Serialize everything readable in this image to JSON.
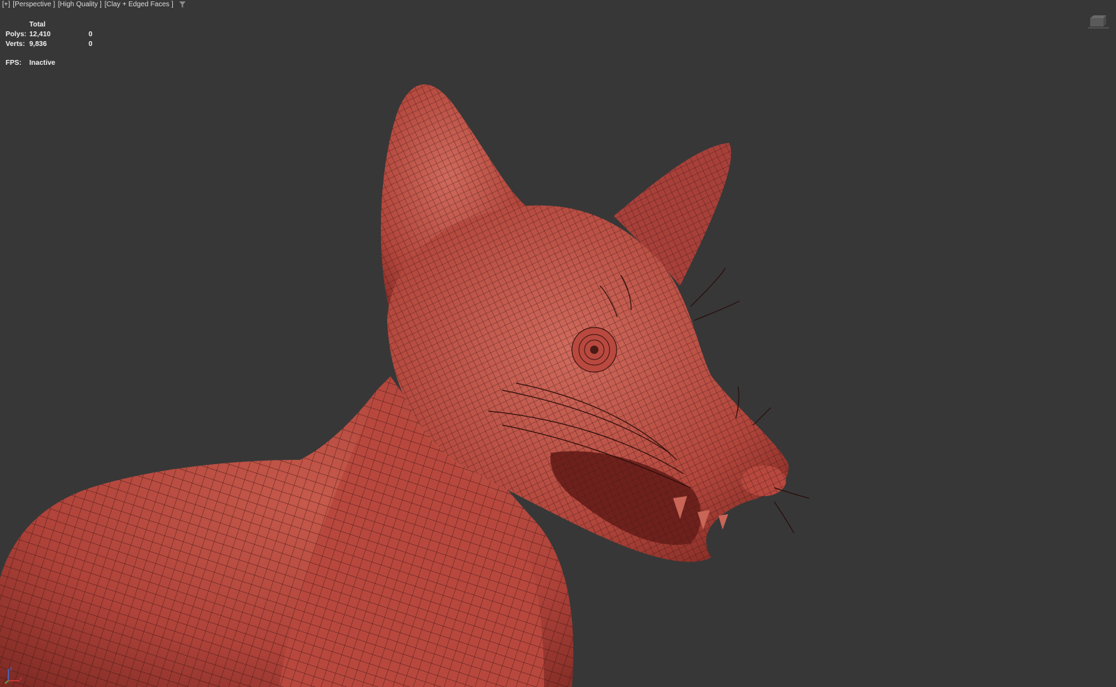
{
  "viewport": {
    "label_plus": "[+]",
    "label_view": "[Perspective ]",
    "label_quality": "[High Quality ]",
    "label_shading": "[Clay + Edged Faces ]",
    "background_color": "#373737"
  },
  "stats": {
    "header": "Total",
    "polys_label": "Polys:",
    "polys_total": "12,410",
    "polys_selected": "0",
    "verts_label": "Verts:",
    "verts_total": "9,836",
    "verts_selected": "0",
    "fps_label": "FPS:",
    "fps_value": "Inactive"
  },
  "icons": {
    "filter": "filter-icon",
    "viewcube": "viewcube-icon",
    "axis": "axis-tripod-icon"
  },
  "model": {
    "description_color": "#b4443a"
  }
}
